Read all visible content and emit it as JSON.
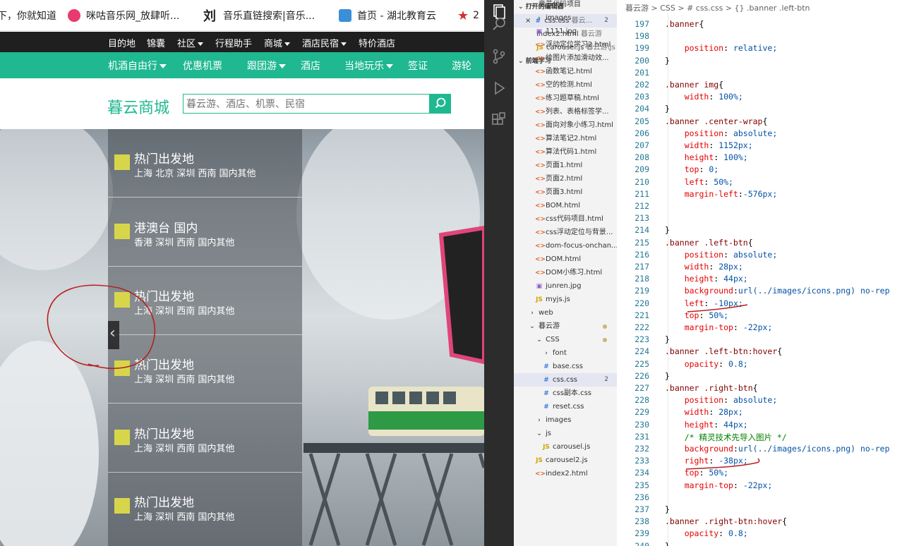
{
  "browser": {
    "bookmarks": [
      {
        "label": "下，你就知道",
        "icon": "page-icon",
        "color": "#ffffff"
      },
      {
        "label": "咪咕音乐网_放肆听...",
        "icon": "migu-icon",
        "color": "#e83a70"
      },
      {
        "label": "音乐直链搜索|音乐...",
        "icon": "liu-icon",
        "color": "#222222"
      },
      {
        "label": "首页 - 湖北教育云",
        "icon": "hubei-icon",
        "color": "#3a8fd8"
      },
      {
        "label": "2",
        "icon": "star-icon",
        "color": "#d32f2f"
      }
    ],
    "topnav": [
      "目的地",
      "锦囊",
      "社区",
      "行程助手",
      "商城",
      "酒店民宿",
      "特价酒店"
    ],
    "topnav_caret": [
      false,
      false,
      true,
      false,
      true,
      true,
      false
    ],
    "greennav": [
      "机酒自由行",
      "优惠机票",
      "跟团游",
      "酒店",
      "当地玩乐",
      "签证",
      "游轮"
    ],
    "greennav_caret": [
      true,
      false,
      true,
      false,
      true,
      false,
      false
    ],
    "logo": "暮云商城",
    "search_placeholder": "暮云游、酒店、机票、民宿",
    "categories": [
      {
        "title": "热门出发地",
        "sub": "上海 北京 深圳 西南 国内其他"
      },
      {
        "title": "港澳台 国内",
        "sub": "香港 深圳 西南 国内其他"
      },
      {
        "title": "热门出发地",
        "sub": "上海 深圳 西南 国内其他"
      },
      {
        "title": "热门出发地",
        "sub": "上海 深圳 西南 国内其他"
      },
      {
        "title": "热门出发地",
        "sub": "上海 深圳 西南 国内其他"
      },
      {
        "title": "热门出发地",
        "sub": "上海 深圳 西南 国内其他"
      }
    ],
    "left_btn_glyph": "‹",
    "accent": "#1fb890"
  },
  "sidebar": {
    "open_editors_title": "打开的编辑器",
    "open_editors": [
      {
        "name": "css.css",
        "hint": "暮云...",
        "type": "css",
        "count": "2",
        "close": "×"
      },
      {
        "name": "index2.html",
        "hint": "暮云游",
        "type": "html"
      },
      {
        "name": "carousel.js",
        "hint": "暮云游\\js",
        "type": "js"
      }
    ],
    "workspace_title": "前端学习",
    "tree": [
      {
        "name": "章节代码项目",
        "kind": "folder",
        "open": true,
        "indent": 1
      },
      {
        "name": "images",
        "kind": "folder",
        "open": false,
        "indent": 2
      },
      {
        "name": "1111.jpg",
        "kind": "img",
        "indent": 2
      },
      {
        "name": "浮动定位学习2.html",
        "kind": "html",
        "indent": 2
      },
      {
        "name": "给图片添加滑动效...",
        "kind": "html",
        "indent": 2
      },
      {
        "name": "函数笔记.html",
        "kind": "html",
        "indent": 2
      },
      {
        "name": "空的检测.html",
        "kind": "html",
        "indent": 2
      },
      {
        "name": "练习题草稿.html",
        "kind": "html",
        "indent": 2
      },
      {
        "name": "列表、表格标签学...",
        "kind": "html",
        "indent": 2
      },
      {
        "name": "面向对象小练习.html",
        "kind": "html",
        "indent": 2
      },
      {
        "name": "算法笔记2.html",
        "kind": "html",
        "indent": 2
      },
      {
        "name": "算法代码1.html",
        "kind": "html",
        "indent": 2
      },
      {
        "name": "页面1.html",
        "kind": "html",
        "indent": 2
      },
      {
        "name": "页面2.html",
        "kind": "html",
        "indent": 2
      },
      {
        "name": "页面3.html",
        "kind": "html",
        "indent": 2
      },
      {
        "name": "BOM.html",
        "kind": "html",
        "indent": 2
      },
      {
        "name": "css代码项目.html",
        "kind": "html",
        "indent": 2
      },
      {
        "name": "css浮动定位与背景...",
        "kind": "html",
        "indent": 2
      },
      {
        "name": "dom-focus-onchan...",
        "kind": "html",
        "indent": 2
      },
      {
        "name": "DOM.html",
        "kind": "html",
        "indent": 2
      },
      {
        "name": "DOM小练习.html",
        "kind": "html",
        "indent": 2
      },
      {
        "name": "junren.jpg",
        "kind": "img",
        "indent": 2
      },
      {
        "name": "myjs.js",
        "kind": "js",
        "indent": 2
      },
      {
        "name": "web",
        "kind": "folder",
        "open": false,
        "indent": 1
      },
      {
        "name": "暮云游",
        "kind": "folder",
        "open": true,
        "indent": 1,
        "dot": true
      },
      {
        "name": "CSS",
        "kind": "folder",
        "open": true,
        "indent": 2,
        "dot": true
      },
      {
        "name": "font",
        "kind": "folder",
        "open": false,
        "indent": 3
      },
      {
        "name": "base.css",
        "kind": "css",
        "indent": 3
      },
      {
        "name": "css.css",
        "kind": "css",
        "indent": 3,
        "count": "2",
        "selected": true
      },
      {
        "name": "css副本.css",
        "kind": "css",
        "indent": 3
      },
      {
        "name": "reset.css",
        "kind": "css",
        "indent": 3
      },
      {
        "name": "images",
        "kind": "folder",
        "open": false,
        "indent": 2
      },
      {
        "name": "js",
        "kind": "folder",
        "open": true,
        "indent": 2
      },
      {
        "name": "carousel.js",
        "kind": "js",
        "indent": 3
      },
      {
        "name": "carousel2.js",
        "kind": "js",
        "indent": 2
      },
      {
        "name": "index2.html",
        "kind": "html",
        "indent": 2
      }
    ]
  },
  "editor": {
    "breadcrumb": "暮云游 > CSS > # css.css > {} .banner .left-btn",
    "lines": [
      {
        "n": "197",
        "t": ".banner{"
      },
      {
        "n": "198",
        "t": ""
      },
      {
        "n": "199",
        "t": "    position: relative;"
      },
      {
        "n": "200",
        "t": "}"
      },
      {
        "n": "201",
        "t": ""
      },
      {
        "n": "202",
        "t": ".banner img{"
      },
      {
        "n": "203",
        "t": "    width: 100%;"
      },
      {
        "n": "204",
        "t": "}"
      },
      {
        "n": "205",
        "t": ".banner .center-wrap{"
      },
      {
        "n": "206",
        "t": "    position: absolute;"
      },
      {
        "n": "207",
        "t": "    width: 1152px;"
      },
      {
        "n": "208",
        "t": "    height: 100%;"
      },
      {
        "n": "209",
        "t": "    top: 0;"
      },
      {
        "n": "210",
        "t": "    left: 50%;"
      },
      {
        "n": "211",
        "t": "    margin-left:-576px;"
      },
      {
        "n": "212",
        "t": ""
      },
      {
        "n": "213",
        "t": ""
      },
      {
        "n": "214",
        "t": "}"
      },
      {
        "n": "215",
        "t": ".banner .left-btn{"
      },
      {
        "n": "216",
        "t": "    position: absolute;"
      },
      {
        "n": "217",
        "t": "    width: 28px;"
      },
      {
        "n": "218",
        "t": "    height: 44px;"
      },
      {
        "n": "219",
        "t": "    background:url(../images/icons.png) no-rep"
      },
      {
        "n": "220",
        "t": "    left: -10px;"
      },
      {
        "n": "221",
        "t": "    top: 50%;"
      },
      {
        "n": "222",
        "t": "    margin-top: -22px;"
      },
      {
        "n": "223",
        "t": "}"
      },
      {
        "n": "224",
        "t": ".banner .left-btn:hover{"
      },
      {
        "n": "225",
        "t": "    opacity: 0.8;"
      },
      {
        "n": "226",
        "t": "}"
      },
      {
        "n": "227",
        "t": ".banner .right-btn{"
      },
      {
        "n": "228",
        "t": "    position: absolute;"
      },
      {
        "n": "229",
        "t": "    width: 28px;"
      },
      {
        "n": "230",
        "t": "    height: 44px;"
      },
      {
        "n": "231",
        "t": "    /* 精灵技术先导入图片 */"
      },
      {
        "n": "232",
        "t": "    background:url(../images/icons.png) no-rep"
      },
      {
        "n": "233",
        "t": "    right: -38px;"
      },
      {
        "n": "234",
        "t": "    top: 50%;"
      },
      {
        "n": "235",
        "t": "    margin-top: -22px;"
      },
      {
        "n": "236",
        "t": ""
      },
      {
        "n": "237",
        "t": "}"
      },
      {
        "n": "238",
        "t": ".banner .right-btn:hover{"
      },
      {
        "n": "239",
        "t": "    opacity: 0.8;"
      },
      {
        "n": "240",
        "t": "}"
      }
    ]
  }
}
